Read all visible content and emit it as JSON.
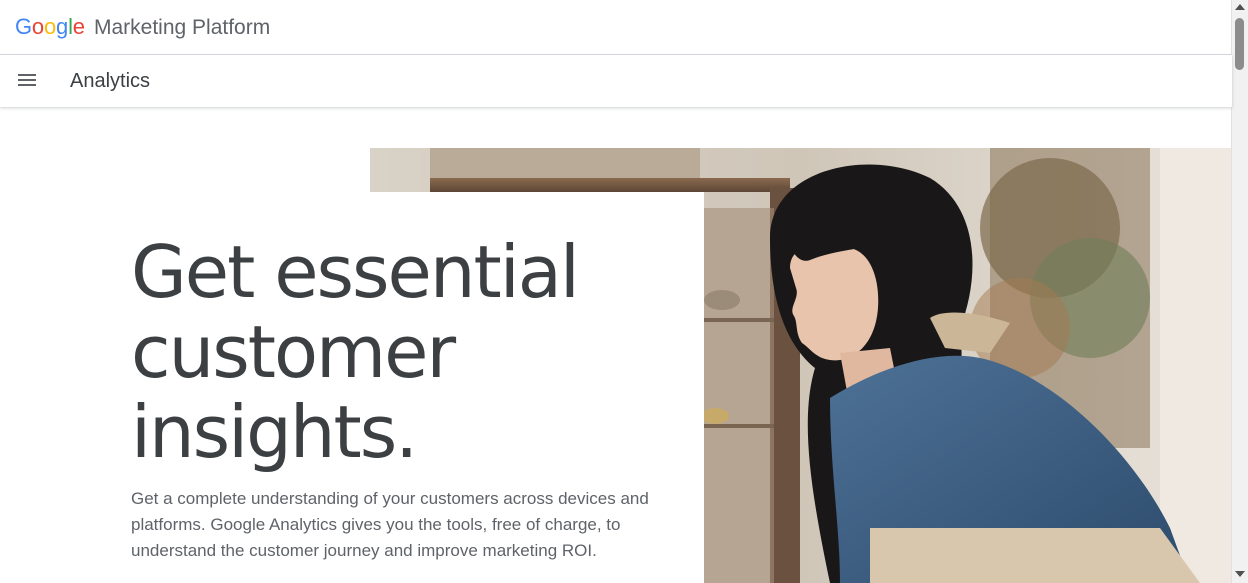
{
  "brand": {
    "logo_letters": [
      {
        "char": "G",
        "color": "#4285F4"
      },
      {
        "char": "o",
        "color": "#EA4335"
      },
      {
        "char": "o",
        "color": "#FBBC05"
      },
      {
        "char": "g",
        "color": "#4285F4"
      },
      {
        "char": "l",
        "color": "#34A853"
      },
      {
        "char": "e",
        "color": "#EA4335"
      }
    ],
    "name": "Marketing Platform"
  },
  "nav": {
    "menu_icon": "hamburger-menu-icon",
    "product_title": "Analytics"
  },
  "hero": {
    "heading_lines": [
      "Get essential",
      "customer",
      "insights."
    ],
    "body": "Get a complete understanding of your customers across devices and platforms. Google Analytics gives you the tools, free of charge, to understand the customer journey and improve marketing ROI.",
    "image_description_icon": "hero-photo"
  },
  "colors": {
    "text_primary": "#3c4043",
    "text_secondary": "#5f6368",
    "divider": "#dadce0"
  }
}
